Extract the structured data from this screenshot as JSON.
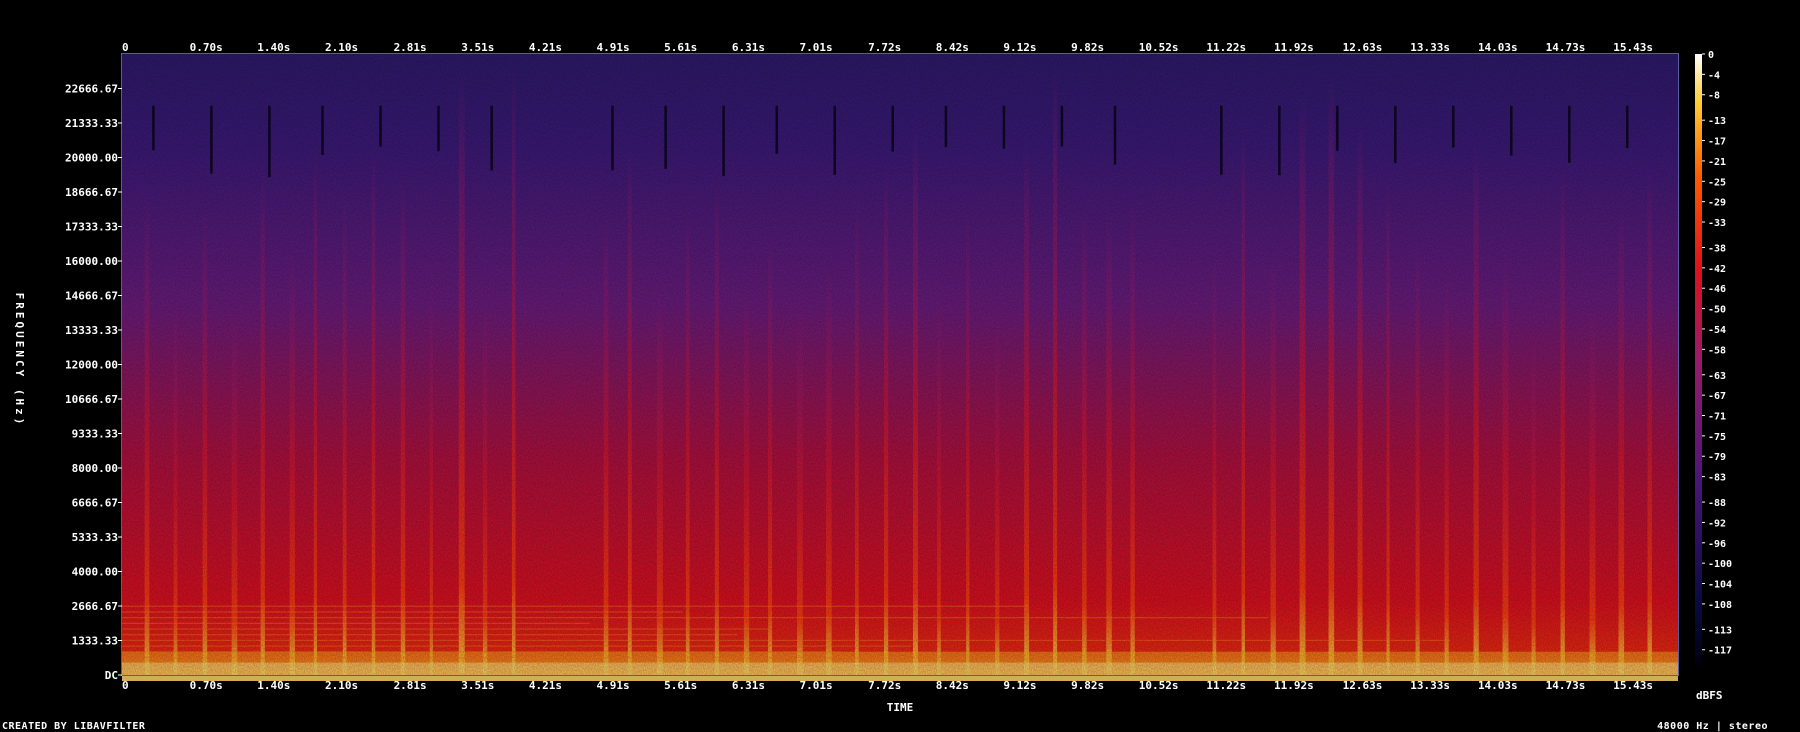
{
  "footer": {
    "created_by": "CREATED BY LIBAVFILTER",
    "format": "48000 Hz | stereo"
  },
  "colors": {
    "background": "#000000",
    "low": "#0a0a3a",
    "mid": "#6a1a8a",
    "high": "#ff1a00",
    "peak": "#ffffff"
  },
  "chart_data": {
    "type": "heatmap",
    "xlabel": "TIME",
    "ylabel": "FREQUENCY (Hz)",
    "colorbar_label": "dBFS",
    "x_ticks": [
      "0",
      "0.70s",
      "1.40s",
      "2.10s",
      "2.81s",
      "3.51s",
      "4.21s",
      "4.91s",
      "5.61s",
      "6.31s",
      "7.01s",
      "7.72s",
      "8.42s",
      "9.12s",
      "9.82s",
      "10.52s",
      "11.22s",
      "11.92s",
      "12.63s",
      "13.33s",
      "14.03s",
      "14.73s",
      "15.43s"
    ],
    "x_tick_values": [
      0,
      0.7,
      1.4,
      2.1,
      2.81,
      3.51,
      4.21,
      4.91,
      5.61,
      6.31,
      7.01,
      7.72,
      8.42,
      9.12,
      9.82,
      10.52,
      11.22,
      11.92,
      12.63,
      13.33,
      14.03,
      14.73,
      15.43
    ],
    "xlim": [
      0,
      16.1
    ],
    "y_ticks": [
      "22666.67",
      "21333.33",
      "20000.00",
      "18666.67",
      "17333.33",
      "16000.00",
      "14666.67",
      "13333.33",
      "12000.00",
      "10666.67",
      "9333.33",
      "8000.00",
      "6666.67",
      "5333.33",
      "4000.00",
      "2666.67",
      "1333.33",
      "DC"
    ],
    "y_tick_values": [
      22666.67,
      21333.33,
      20000,
      18666.67,
      17333.33,
      16000,
      14666.67,
      13333.33,
      12000,
      10666.67,
      9333.33,
      8000,
      6666.67,
      5333.33,
      4000,
      2666.67,
      1333.33,
      0
    ],
    "ylim": [
      0,
      24000
    ],
    "colorbar_ticks": [
      "0",
      "-4",
      "-8",
      "-13",
      "-17",
      "-21",
      "-25",
      "-29",
      "-33",
      "-38",
      "-42",
      "-46",
      "-50",
      "-54",
      "-58",
      "-63",
      "-67",
      "-71",
      "-75",
      "-79",
      "-83",
      "-88",
      "-92",
      "-96",
      "-100",
      "-104",
      "-108",
      "-113",
      "-117"
    ],
    "colorbar_values": [
      0,
      -4,
      -8,
      -13,
      -17,
      -21,
      -25,
      -29,
      -33,
      -38,
      -42,
      -46,
      -50,
      -54,
      -58,
      -63,
      -67,
      -71,
      -75,
      -79,
      -83,
      -88,
      -92,
      -96,
      -100,
      -104,
      -108,
      -113,
      -117
    ],
    "colorbar_range": [
      -120,
      0
    ],
    "transients_s": [
      0.25,
      0.55,
      0.85,
      1.15,
      1.45,
      1.75,
      2.0,
      2.3,
      2.6,
      2.9,
      3.2,
      3.5,
      3.75,
      4.05,
      5.0,
      5.25,
      5.55,
      5.85,
      6.15,
      6.45,
      6.7,
      7.0,
      7.3,
      7.6,
      7.9,
      8.2,
      8.45,
      8.75,
      9.05,
      9.35,
      9.65,
      9.95,
      10.2,
      10.45,
      11.3,
      11.6,
      11.9,
      12.2,
      12.5,
      12.8,
      13.1,
      13.4,
      13.7,
      14.0,
      14.3,
      14.6,
      14.9,
      15.2,
      15.5,
      15.8
    ]
  }
}
